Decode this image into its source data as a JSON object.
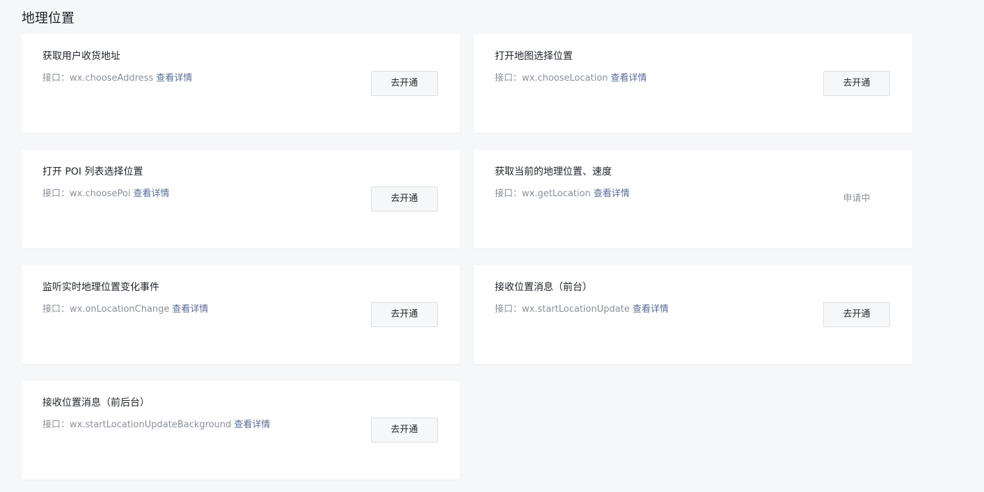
{
  "section": {
    "title": "地理位置"
  },
  "common": {
    "api_prefix": "接口：",
    "detail_link": "查看详情",
    "open_button": "去开通"
  },
  "cards": [
    {
      "title": "获取用户收货地址",
      "api": "wx.chooseAddress",
      "action": "button"
    },
    {
      "title": "打开地图选择位置",
      "api": "wx.chooseLocation",
      "action": "button"
    },
    {
      "title": "打开 POI 列表选择位置",
      "api": "wx.choosePoi",
      "action": "button"
    },
    {
      "title": "获取当前的地理位置、速度",
      "api": "wx.getLocation",
      "action": "status",
      "status": "申请中"
    },
    {
      "title": "监听实时地理位置变化事件",
      "api": "wx.onLocationChange",
      "action": "button"
    },
    {
      "title": "接收位置消息（前台）",
      "api": "wx.startLocationUpdate",
      "action": "button"
    },
    {
      "title": "接收位置消息（前后台）",
      "api": "wx.startLocationUpdateBackground",
      "action": "button"
    }
  ],
  "colors": {
    "page_background": "#f6f7f9",
    "card_background": "#ffffff",
    "link": "#576b95",
    "muted_text": "#8a8f99",
    "button_border": "#dcdee2"
  }
}
